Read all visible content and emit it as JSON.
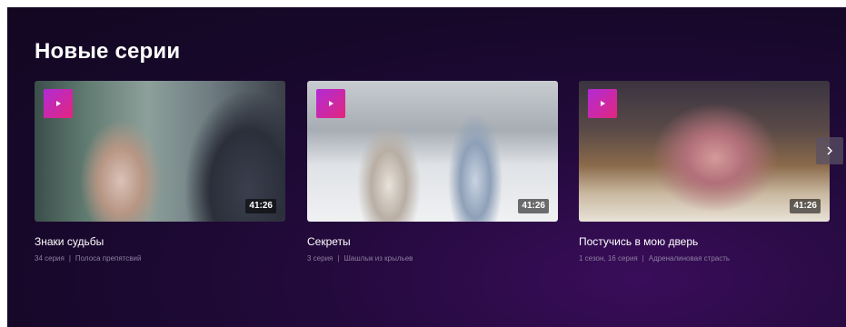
{
  "section": {
    "title": "Новые серии"
  },
  "cards": [
    {
      "title": "Знаки судьбы",
      "episode": "34 серия",
      "episode_name": "Полоса препятсвий",
      "duration": "41:26"
    },
    {
      "title": "Секреты",
      "episode": "3 серия",
      "episode_name": "Шашлык из крыльев",
      "duration": "41:26"
    },
    {
      "title": "Постучись в мою дверь",
      "episode": "1 сезон, 16 серия",
      "episode_name": "Адреналиновая страсть",
      "duration": "41:26"
    }
  ],
  "meta_separator": "|",
  "icons": {
    "play": "play-icon",
    "next": "chevron-right-icon"
  },
  "colors": {
    "background": "#17082a",
    "badge_start": "#b12bd6",
    "badge_end": "#e2267e",
    "meta_text": "#8d7fa0"
  }
}
